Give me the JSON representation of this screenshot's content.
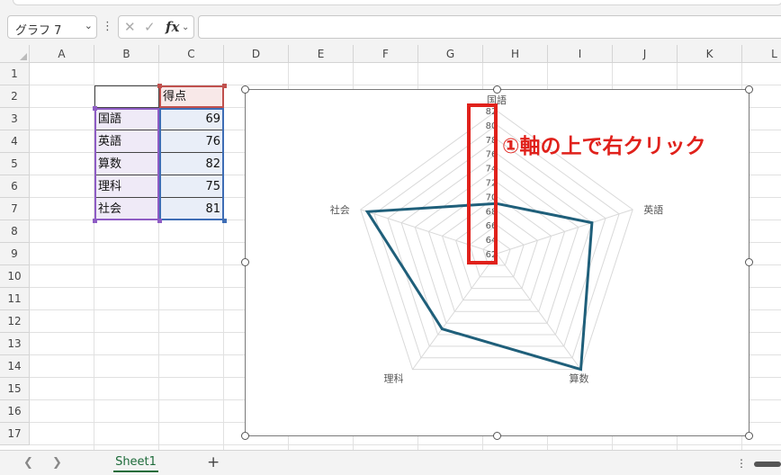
{
  "name_box": {
    "value": "グラフ 7"
  },
  "formula_bar": {
    "fx_label": "fx",
    "value": ""
  },
  "columns": [
    "A",
    "B",
    "C",
    "D",
    "E",
    "F",
    "G",
    "H",
    "I",
    "J",
    "K",
    "L"
  ],
  "rows": [
    "1",
    "2",
    "3",
    "4",
    "5",
    "6",
    "7",
    "8",
    "9",
    "10",
    "11",
    "12",
    "13",
    "14",
    "15",
    "16",
    "17"
  ],
  "table": {
    "header": "得点",
    "rows": [
      {
        "label": "国語",
        "value": "69"
      },
      {
        "label": "英語",
        "value": "76"
      },
      {
        "label": "算数",
        "value": "82"
      },
      {
        "label": "理科",
        "value": "75"
      },
      {
        "label": "社会",
        "value": "81"
      }
    ]
  },
  "chart_data": {
    "type": "radar",
    "categories": [
      "国語",
      "英語",
      "算数",
      "理科",
      "社会"
    ],
    "series": [
      {
        "values": [
          69,
          76,
          82,
          75,
          81
        ]
      }
    ],
    "axis_ticks": [
      "62",
      "64",
      "66",
      "68",
      "70",
      "72",
      "74",
      "76",
      "78",
      "80",
      "82"
    ],
    "rmin": 62,
    "rmax": 82,
    "line_color": "#1f5f7a"
  },
  "annotation": {
    "text": "①軸の上で右クリック",
    "color": "#e0211b"
  },
  "sheet_tabs": {
    "active": "Sheet1",
    "add": "+"
  },
  "colors": {
    "accent_green": "#1d6b3a"
  }
}
